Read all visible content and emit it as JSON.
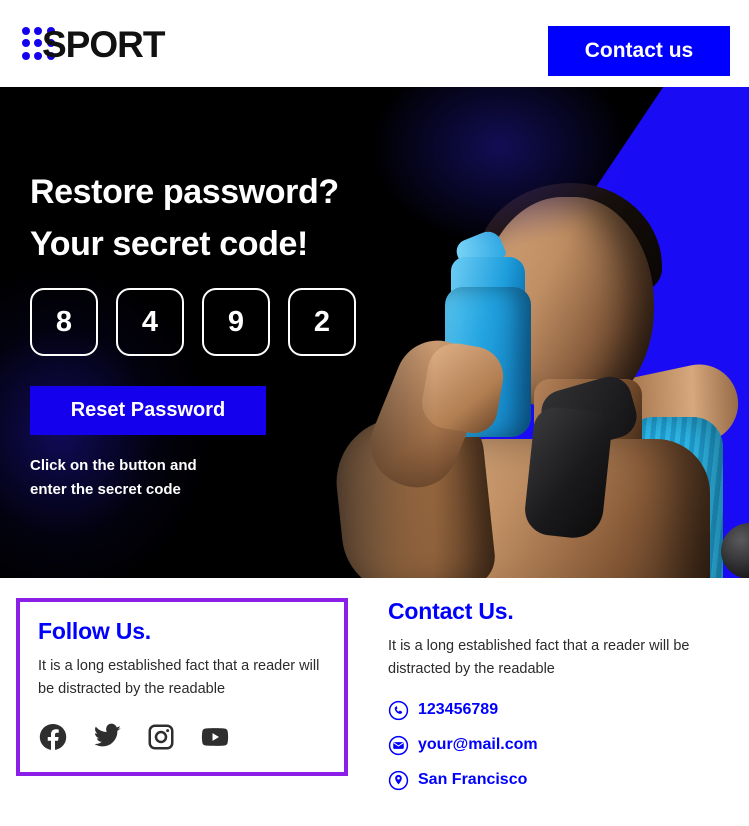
{
  "header": {
    "logo_word": "SPORT",
    "logo_dots_icon": "dot-grid-icon",
    "contact_us_label": "Contact us"
  },
  "hero": {
    "title_line1": "Restore password?",
    "title_line2": "Your secret code!",
    "code_digits": [
      "8",
      "4",
      "9",
      "2"
    ],
    "reset_label": "Reset Password",
    "hint_line1": "Click on the button and",
    "hint_line2": "enter the secret code",
    "background_color": "#000000",
    "accent_color": "#1500ee",
    "image_alt": "athlete-holding-blue-shaker-bottle"
  },
  "footer": {
    "follow": {
      "title": "Follow Us.",
      "text": "It is a long established fact that a reader will be distracted by the readable",
      "border_color": "#8b1fe8",
      "socials": [
        {
          "name": "facebook",
          "icon": "facebook-icon"
        },
        {
          "name": "twitter",
          "icon": "twitter-icon"
        },
        {
          "name": "instagram",
          "icon": "instagram-icon"
        },
        {
          "name": "youtube",
          "icon": "youtube-icon"
        }
      ]
    },
    "contact": {
      "title": "Contact Us.",
      "text": "It is a long established fact that a reader will be distracted by the readable",
      "items": [
        {
          "icon": "phone-icon",
          "value": "123456789"
        },
        {
          "icon": "mail-icon",
          "value": "your@mail.com"
        },
        {
          "icon": "location-pin-icon",
          "value": "San Francisco"
        }
      ]
    },
    "link_color": "#0000ff"
  }
}
